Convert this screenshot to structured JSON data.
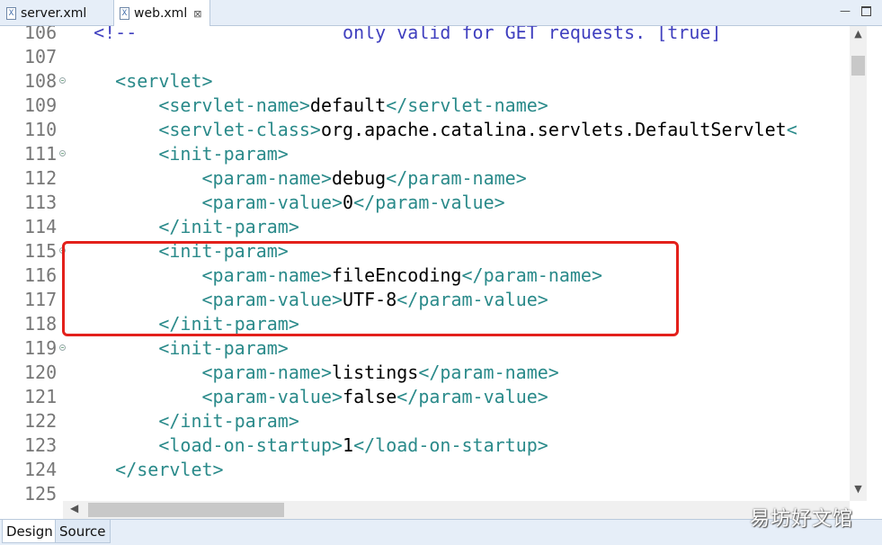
{
  "tabs": [
    {
      "label": "server.xml",
      "active": false
    },
    {
      "label": "web.xml",
      "active": true
    }
  ],
  "tab_close_glyph": "⊠",
  "window_buttons": {
    "minimize": "—",
    "maximize": ""
  },
  "editor": {
    "lines": [
      {
        "num": "106",
        "fold": false,
        "parts": [
          {
            "c": "cmt",
            "t": "  <!--                   only valid for GET requests. [true]"
          }
        ]
      },
      {
        "num": "107",
        "fold": false,
        "parts": []
      },
      {
        "num": "108",
        "fold": true,
        "parts": [
          {
            "c": "tag",
            "t": "    <servlet>"
          }
        ]
      },
      {
        "num": "109",
        "fold": false,
        "parts": [
          {
            "c": "tag",
            "t": "        <servlet-name>"
          },
          {
            "c": "txt",
            "t": "default"
          },
          {
            "c": "tag",
            "t": "</servlet-name>"
          }
        ]
      },
      {
        "num": "110",
        "fold": false,
        "parts": [
          {
            "c": "tag",
            "t": "        <servlet-class>"
          },
          {
            "c": "txt",
            "t": "org.apache.catalina.servlets.DefaultServlet"
          },
          {
            "c": "tag",
            "t": "<"
          }
        ]
      },
      {
        "num": "111",
        "fold": true,
        "parts": [
          {
            "c": "tag",
            "t": "        <init-param>"
          }
        ]
      },
      {
        "num": "112",
        "fold": false,
        "parts": [
          {
            "c": "tag",
            "t": "            <param-name>"
          },
          {
            "c": "txt",
            "t": "debug"
          },
          {
            "c": "tag",
            "t": "</param-name>"
          }
        ]
      },
      {
        "num": "113",
        "fold": false,
        "parts": [
          {
            "c": "tag",
            "t": "            <param-value>"
          },
          {
            "c": "txt",
            "t": "0"
          },
          {
            "c": "tag",
            "t": "</param-value>"
          }
        ]
      },
      {
        "num": "114",
        "fold": false,
        "parts": [
          {
            "c": "tag",
            "t": "        </init-param>"
          }
        ]
      },
      {
        "num": "115",
        "fold": true,
        "parts": [
          {
            "c": "tag",
            "t": "        <init-param>"
          }
        ]
      },
      {
        "num": "116",
        "fold": false,
        "parts": [
          {
            "c": "tag",
            "t": "            <param-name>"
          },
          {
            "c": "txt",
            "t": "fileEncoding"
          },
          {
            "c": "tag",
            "t": "</param-name>"
          }
        ]
      },
      {
        "num": "117",
        "fold": false,
        "parts": [
          {
            "c": "tag",
            "t": "            <param-value>"
          },
          {
            "c": "txt",
            "t": "UTF-8"
          },
          {
            "c": "tag",
            "t": "</param-value>"
          }
        ]
      },
      {
        "num": "118",
        "fold": false,
        "parts": [
          {
            "c": "tag",
            "t": "        </init-param>"
          }
        ]
      },
      {
        "num": "119",
        "fold": true,
        "parts": [
          {
            "c": "tag",
            "t": "        <init-param>"
          }
        ]
      },
      {
        "num": "120",
        "fold": false,
        "parts": [
          {
            "c": "tag",
            "t": "            <param-name>"
          },
          {
            "c": "txt",
            "t": "listings"
          },
          {
            "c": "tag",
            "t": "</param-name>"
          }
        ]
      },
      {
        "num": "121",
        "fold": false,
        "parts": [
          {
            "c": "tag",
            "t": "            <param-value>"
          },
          {
            "c": "txt",
            "t": "false"
          },
          {
            "c": "tag",
            "t": "</param-value>"
          }
        ]
      },
      {
        "num": "122",
        "fold": false,
        "parts": [
          {
            "c": "tag",
            "t": "        </init-param>"
          }
        ]
      },
      {
        "num": "123",
        "fold": false,
        "parts": [
          {
            "c": "tag",
            "t": "        <load-on-startup>"
          },
          {
            "c": "txt",
            "t": "1"
          },
          {
            "c": "tag",
            "t": "</load-on-startup>"
          }
        ]
      },
      {
        "num": "124",
        "fold": false,
        "parts": [
          {
            "c": "tag",
            "t": "    </servlet>"
          }
        ]
      },
      {
        "num": "125",
        "fold": false,
        "parts": []
      }
    ]
  },
  "scroll_arrows": {
    "up": "▲",
    "down": "▼",
    "left": "◀"
  },
  "bottom_tabs": [
    {
      "label": "Design",
      "active": true
    },
    {
      "label": "Source",
      "active": false
    }
  ],
  "watermark": "易坊好文馆",
  "colors": {
    "tag": "#2a8a8a",
    "text": "#000000",
    "comment": "#3f3fbf",
    "highlight": "#e3201b"
  }
}
